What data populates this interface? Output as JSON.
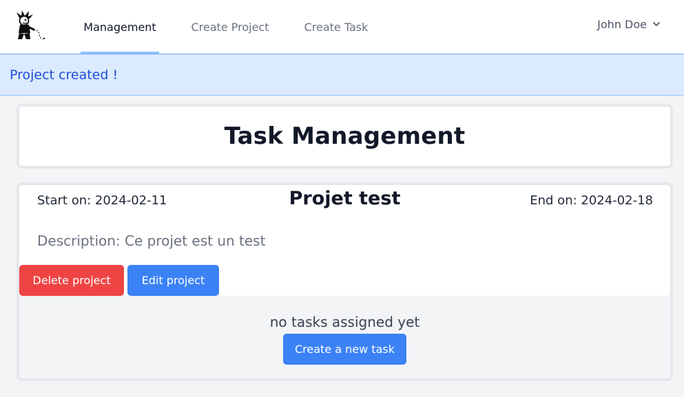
{
  "nav": {
    "tabs": [
      {
        "label": "Management",
        "active": true
      },
      {
        "label": "Create Project",
        "active": false
      },
      {
        "label": "Create Task",
        "active": false
      }
    ],
    "user": {
      "name": "John Doe",
      "icon": "chevron-down-icon"
    },
    "logo_icon": "mascot-logo-icon"
  },
  "alert": {
    "message": "Project created !"
  },
  "title": "Task Management",
  "project": {
    "start": "Start on: 2024-02-11",
    "name": "Projet test",
    "end": "End on: 2024-02-18",
    "description": "Description: Ce projet est un test",
    "delete_label": "Delete project",
    "edit_label": "Edit project"
  },
  "tasks": {
    "empty_message": "no tasks assigned yet",
    "create_label": "Create a new task"
  },
  "colors": {
    "primary": "#3b82f6",
    "danger": "#ef4444",
    "alert_bg": "#dbeafe",
    "alert_text": "#1d4ed8"
  }
}
